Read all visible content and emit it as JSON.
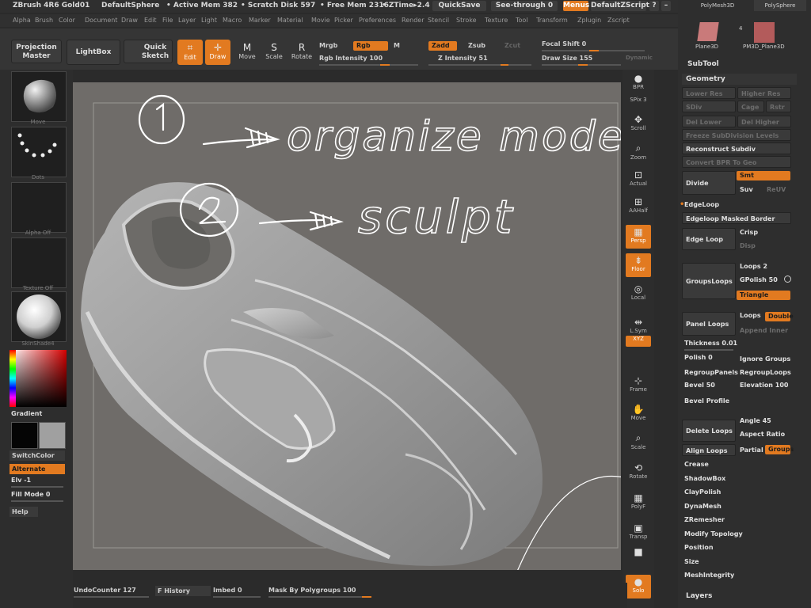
{
  "titlebar": {
    "app": "ZBrush 4R6 Gold01",
    "doc": "DefaultSphere",
    "active_mem": "• Active Mem 382",
    "scratch": "• Scratch Disk 597",
    "free_mem": "• Free Mem 2316",
    "ztime": "• ZTime▸2.4",
    "quicksave": "QuickSave",
    "seethrough": "See-through  0",
    "menus": "Menus",
    "zscript": "DefaultZScript"
  },
  "menubar": [
    "Alpha",
    "Brush",
    "Color",
    "Document",
    "Draw",
    "Edit",
    "File",
    "Layer",
    "Light",
    "Macro",
    "Marker",
    "Material",
    "Movie",
    "Picker",
    "Preferences",
    "Render",
    "Stencil",
    "Stroke",
    "Texture",
    "Tool",
    "Transform",
    "Zplugin",
    "Zscript"
  ],
  "shelf": {
    "projection_master": "Projection\nMaster",
    "lightbox": "LightBox",
    "quick_sketch": "Quick\nSketch",
    "edit": "Edit",
    "draw": "Draw",
    "move": "Move",
    "scale": "Scale",
    "rotate": "Rotate",
    "mrgb": "Mrgb",
    "rgb": "Rgb",
    "m": "M",
    "rgb_intensity": "Rgb  Intensity 100",
    "zadd": "Zadd",
    "zsub": "Zsub",
    "zcut": "Zcut",
    "z_intensity": "Z  Intensity 51",
    "focal_shift": "Focal Shift 0",
    "draw_size": "Draw Size 155",
    "dynamic": "Dynamic"
  },
  "lefttray": {
    "brush": "Move",
    "stroke": "Dots",
    "alpha": "Alpha Off",
    "texture": "Texture Off",
    "material": "SkinShade4",
    "gradient": "Gradient",
    "switchcolor": "SwitchColor",
    "alternate": "Alternate",
    "elv": "Elv -1",
    "fillmode": "Fill Mode 0",
    "help": "Help"
  },
  "annotation": {
    "line1": "organize model",
    "line2": "sculpt",
    "num1": "1",
    "num2": "2"
  },
  "rightbar": [
    {
      "name": "bpr-icon",
      "label": "BPR",
      "on": false
    },
    {
      "name": "spix",
      "label": "SPix 3",
      "on": false
    },
    {
      "name": "scroll-icon",
      "label": "Scroll",
      "on": false
    },
    {
      "name": "zoom-icon",
      "label": "Zoom",
      "on": false
    },
    {
      "name": "actual-icon",
      "label": "Actual",
      "on": false
    },
    {
      "name": "aahalf-icon",
      "label": "AAHalf",
      "on": false
    },
    {
      "name": "persp-icon",
      "label": "Persp",
      "on": true
    },
    {
      "name": "floor-icon",
      "label": "Floor",
      "on": true
    },
    {
      "name": "local-icon",
      "label": "Local",
      "on": false
    },
    {
      "name": "lsym-icon",
      "label": "L.Sym",
      "on": false
    },
    {
      "name": "xyz-icon",
      "label": "XYZ",
      "on": true
    },
    {
      "name": "frame-icon",
      "label": "Frame",
      "on": false
    },
    {
      "name": "move-icon",
      "label": "Move",
      "on": false
    },
    {
      "name": "scale-icon",
      "label": "Scale",
      "on": false
    },
    {
      "name": "rotate-icon",
      "label": "Rotate",
      "on": false
    },
    {
      "name": "polyf-icon",
      "label": "PolyF",
      "on": false
    },
    {
      "name": "transp-icon",
      "label": "Transp",
      "on": false
    },
    {
      "name": "ghost-icon",
      "label": "",
      "on": false
    },
    {
      "name": "solo-icon",
      "label": "Solo",
      "on": true
    }
  ],
  "rpanel": {
    "polymesh": "PolyMesh3D",
    "polysphere": "PolySphere",
    "count": "4",
    "plane3d": "Plane3D",
    "pm3d_plane": "PM3D_Plane3D",
    "subtool": "SubTool",
    "geometry": "Geometry",
    "lower_res": "Lower Res",
    "higher_res": "Higher Res",
    "sdiv": "SDiv",
    "cage": "Cage",
    "rstr": "Rstr",
    "del_lower": "Del Lower",
    "del_higher": "Del Higher",
    "freeze_sub": "Freeze SubDivision Levels",
    "reconstruct": "Reconstruct Subdiv",
    "convert_bpr": "Convert BPR To Geo",
    "divide": "Divide",
    "smt": "Smt",
    "suv": "Suv",
    "reuv": "ReUV",
    "edgeloop": "EdgeLoop",
    "edgeloop_masked": "Edgeloop Masked Border",
    "edge_loop": "Edge Loop",
    "crisp": "Crisp",
    "disp": "Disp",
    "groups_loops": "GroupsLoops",
    "loops2": "Loops 2",
    "gpolish": "GPolish 50",
    "triangle": "Triangle",
    "panel_loops": "Panel Loops",
    "loops": "Loops",
    "double": "Double",
    "append_inner": "Append Inner",
    "thickness": "Thickness 0.01",
    "polish": "Polish 0",
    "ignore_groups": "Ignore Groups",
    "regroup_panels": "RegroupPanels",
    "regroup_loops": "RegroupLoops",
    "bevel": "Bevel 50",
    "elevation": "Elevation 100",
    "bevel_profile": "Bevel Profile",
    "delete_loops": "Delete Loops",
    "angle": "Angle 45",
    "aspect_ratio": "Aspect Ratio",
    "align_loops": "Align Loops",
    "partial": "Partial",
    "groups": "Groups",
    "crease": "Crease",
    "shadowbox": "ShadowBox",
    "claypolish": "ClayPolish",
    "dynamesh": "DynaMesh",
    "zremesher": "ZRemesher",
    "modify_topology": "Modify Topology",
    "position": "Position",
    "size": "Size",
    "meshintegrity": "MeshIntegrity",
    "layers": "Layers"
  },
  "bottombar": {
    "undo": "UndoCounter 127",
    "history": "F History",
    "imbed": "Imbed 0",
    "mask": "Mask By Polygroups 100"
  }
}
